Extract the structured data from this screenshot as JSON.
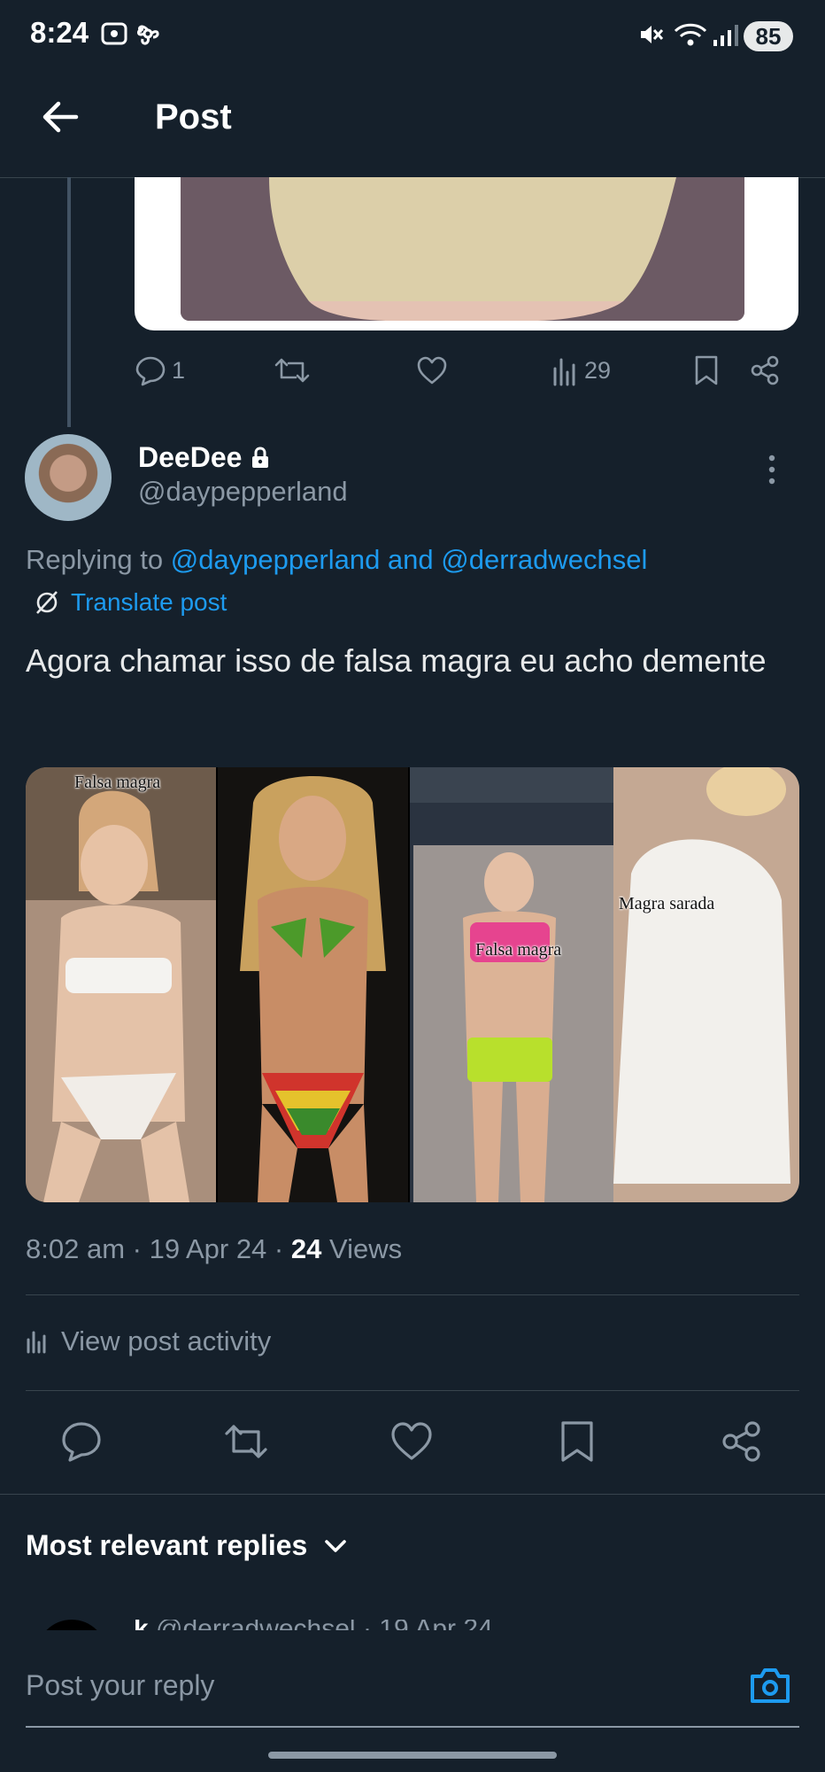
{
  "status_bar": {
    "time": "8:24",
    "battery": "85"
  },
  "header": {
    "title": "Post"
  },
  "previous_tweet": {
    "replies": "1",
    "views": "29"
  },
  "tweet": {
    "display_name": "DeeDee",
    "handle": "@daypepperland",
    "replying_prefix": "Replying to",
    "replying_to": "@daypepperland and @derradwechsel",
    "translate_label": "Translate post",
    "text": "Agora chamar isso de falsa magra eu acho demente",
    "media_captions": [
      "Falsa magra",
      "Falsa magra",
      "Magra sarada"
    ],
    "time": "8:02 am",
    "date": "19 Apr 24",
    "views_count": "24",
    "views_label": "Views",
    "view_activity_label": "View post activity"
  },
  "replies_section": {
    "title": "Most relevant replies"
  },
  "next_reply_peek": {
    "name": "k",
    "handle": "@derradwechsel",
    "date": "19 Apr 24"
  },
  "reply_box": {
    "placeholder": "Post your reply"
  },
  "icons": {
    "back": "arrow-left-icon",
    "reply": "reply-icon",
    "repost": "repost-icon",
    "like": "heart-icon",
    "views": "bar-chart-icon",
    "bookmark": "bookmark-icon",
    "share": "share-icon",
    "lock": "lock-icon",
    "translate": "translate-icon",
    "more": "more-dots-icon",
    "chevron": "chevron-down-icon",
    "camera": "camera-icon"
  },
  "colors": {
    "background": "#15202b",
    "link": "#1d9bf0",
    "muted": "#8b98a5",
    "text": "#e7e9ea"
  }
}
